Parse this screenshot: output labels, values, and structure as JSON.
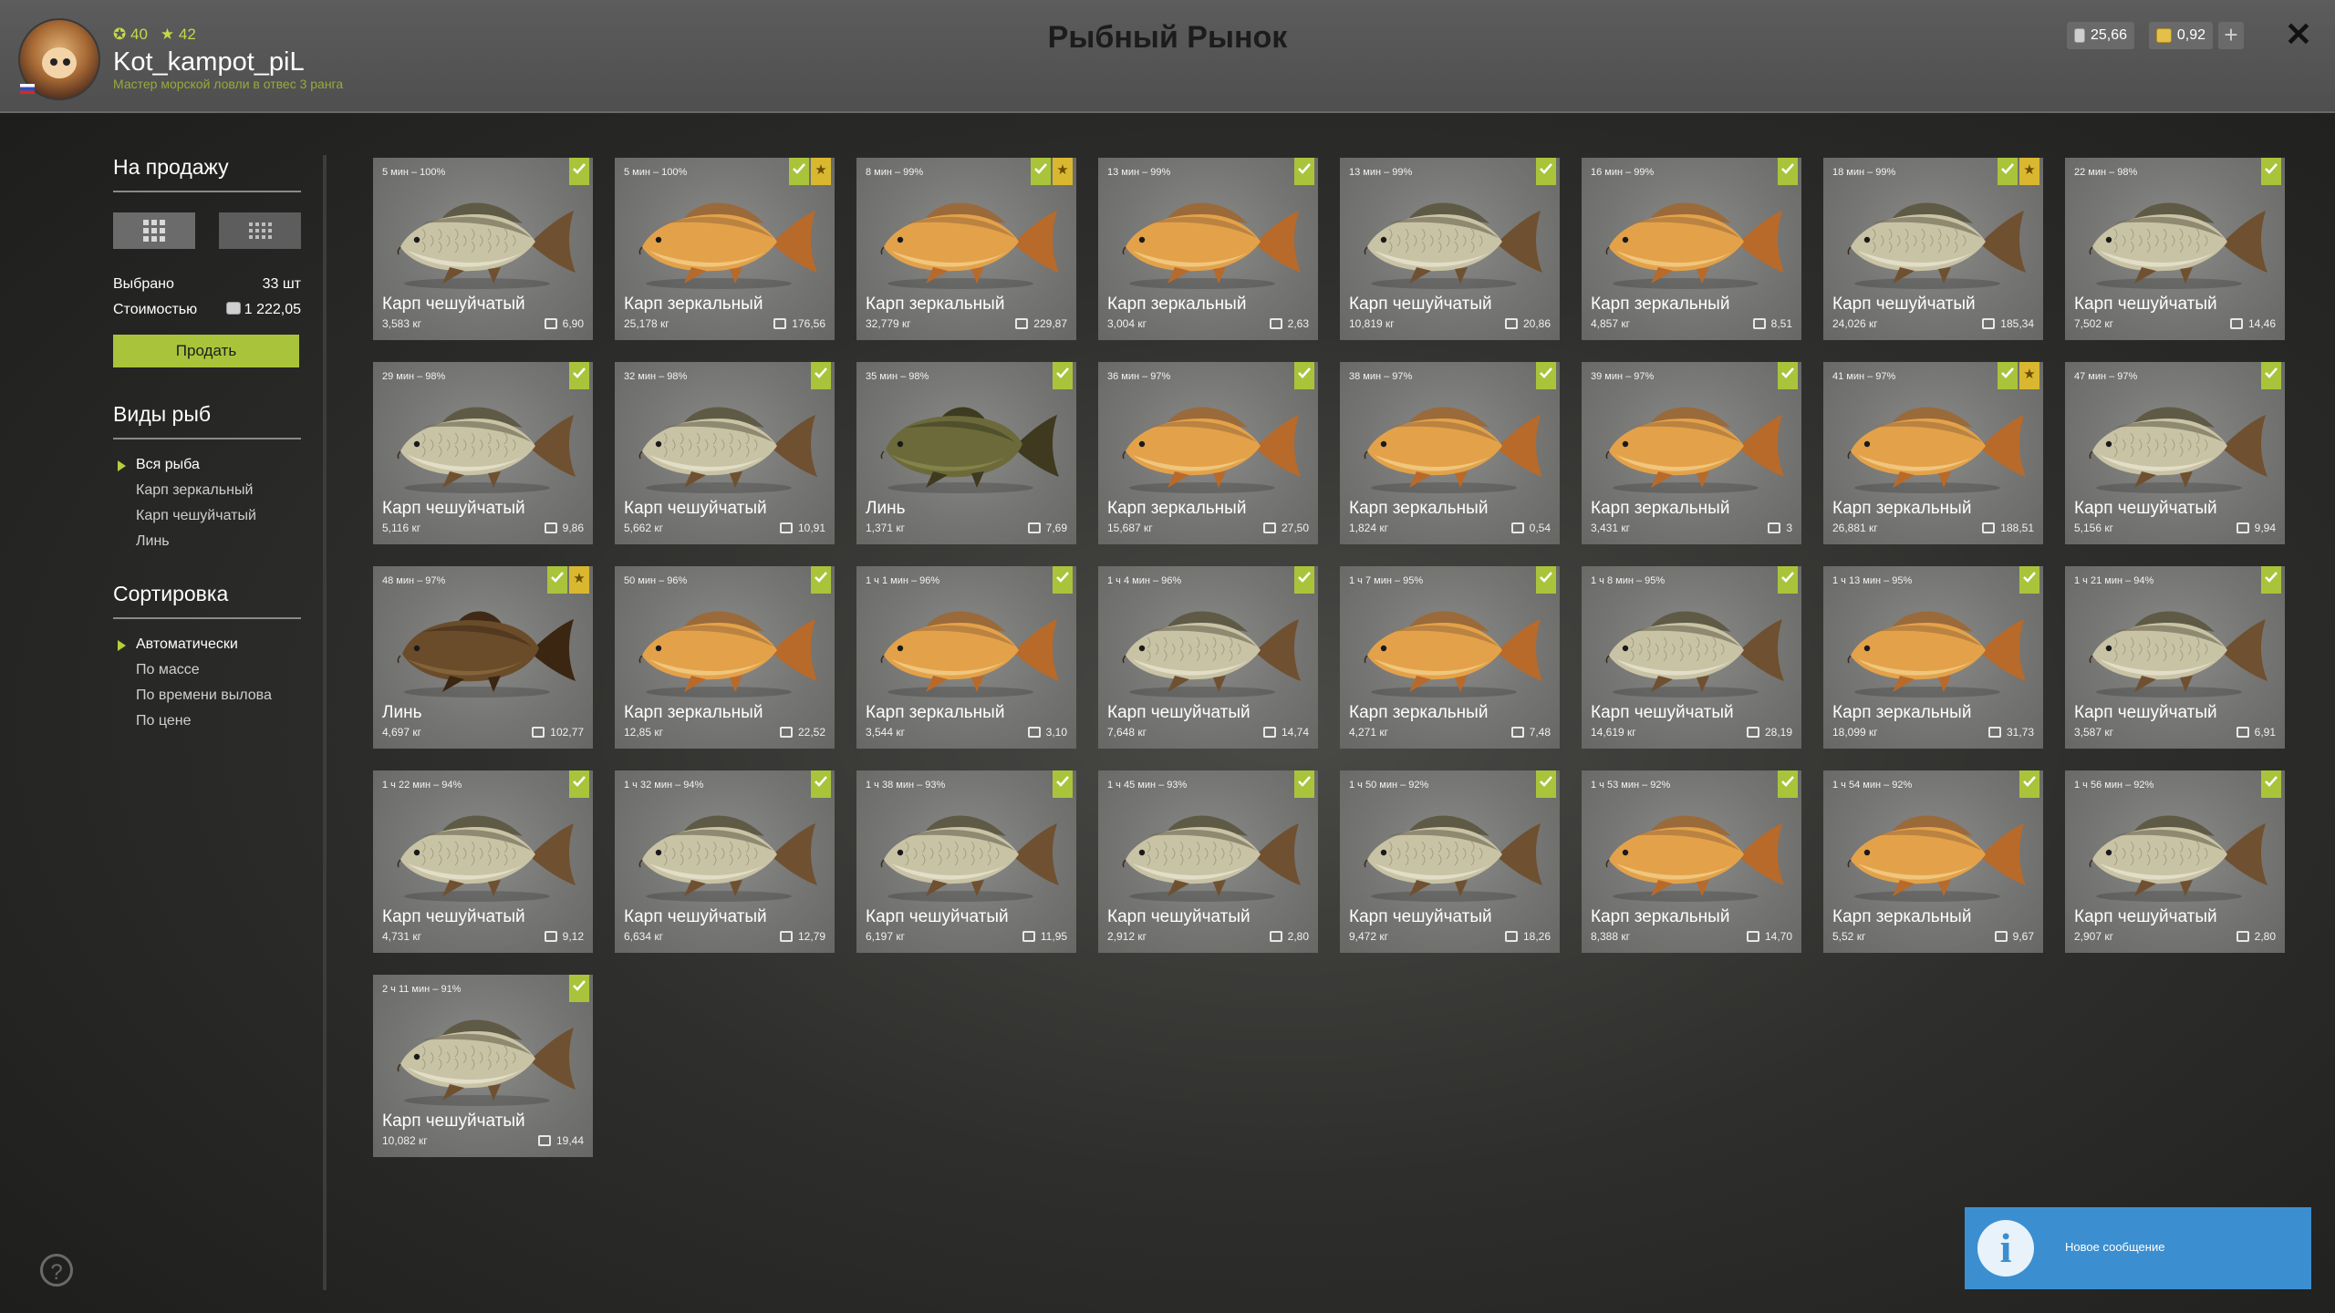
{
  "header": {
    "title": "Рыбный Рынок",
    "player": {
      "level_points": "40",
      "stars": "42",
      "username": "Kot_kampot_piL",
      "rank": "Мастер морской ловли в отвес 3 ранга"
    },
    "silver": "25,66",
    "gold": "0,92",
    "plus_label": "+",
    "close_label": "✕"
  },
  "sidebar": {
    "for_sale_title": "На продажу",
    "selected_label": "Выбрано",
    "selected_value": "33 шт",
    "cost_label": "Стоимостью",
    "cost_value": "1 222,05",
    "sell_label": "Продать",
    "fish_types_title": "Виды рыб",
    "fish_types": [
      "Вся рыба",
      "Карп зеркальный",
      "Карп чешуйчатый",
      "Линь"
    ],
    "sort_title": "Сортировка",
    "sort_options": [
      "Автоматически",
      "По массе",
      "По времени вылова",
      "По цене"
    ]
  },
  "toast": {
    "icon": "i",
    "message": "Новое сообщение"
  },
  "help_icon": "?",
  "colors": {
    "accent": "#a9c43a",
    "star": "#d9b830",
    "toast": "#3b8fd0"
  },
  "fish": [
    {
      "time": "5 мин – 100%",
      "name": "Карп чешуйчатый",
      "weight": "3,583 кг",
      "price": "6,90",
      "kind": "common",
      "star": false
    },
    {
      "time": "5 мин – 100%",
      "name": "Карп зеркальный",
      "weight": "25,178 кг",
      "price": "176,56",
      "kind": "mirror",
      "star": true
    },
    {
      "time": "8 мин – 99%",
      "name": "Карп зеркальный",
      "weight": "32,779 кг",
      "price": "229,87",
      "kind": "mirror",
      "star": true
    },
    {
      "time": "13 мин – 99%",
      "name": "Карп зеркальный",
      "weight": "3,004 кг",
      "price": "2,63",
      "kind": "mirror",
      "star": false
    },
    {
      "time": "13 мин – 99%",
      "name": "Карп чешуйчатый",
      "weight": "10,819 кг",
      "price": "20,86",
      "kind": "common",
      "star": false
    },
    {
      "time": "16 мин – 99%",
      "name": "Карп зеркальный",
      "weight": "4,857 кг",
      "price": "8,51",
      "kind": "mirror",
      "star": false
    },
    {
      "time": "18 мин – 99%",
      "name": "Карп чешуйчатый",
      "weight": "24,026 кг",
      "price": "185,34",
      "kind": "common",
      "star": true
    },
    {
      "time": "22 мин – 98%",
      "name": "Карп чешуйчатый",
      "weight": "7,502 кг",
      "price": "14,46",
      "kind": "common",
      "star": false
    },
    {
      "time": "29 мин – 98%",
      "name": "Карп чешуйчатый",
      "weight": "5,116 кг",
      "price": "9,86",
      "kind": "common",
      "star": false
    },
    {
      "time": "32 мин – 98%",
      "name": "Карп чешуйчатый",
      "weight": "5,662 кг",
      "price": "10,91",
      "kind": "common",
      "star": false
    },
    {
      "time": "35 мин – 98%",
      "name": "Линь",
      "weight": "1,371 кг",
      "price": "7,69",
      "kind": "tench",
      "star": false
    },
    {
      "time": "36 мин – 97%",
      "name": "Карп зеркальный",
      "weight": "15,687 кг",
      "price": "27,50",
      "kind": "mirror",
      "star": false
    },
    {
      "time": "38 мин – 97%",
      "name": "Карп зеркальный",
      "weight": "1,824 кг",
      "price": "0,54",
      "kind": "mirror",
      "star": false
    },
    {
      "time": "39 мин – 97%",
      "name": "Карп зеркальный",
      "weight": "3,431 кг",
      "price": "3",
      "kind": "mirror",
      "star": false
    },
    {
      "time": "41 мин – 97%",
      "name": "Карп зеркальный",
      "weight": "26,881 кг",
      "price": "188,51",
      "kind": "mirror",
      "star": true
    },
    {
      "time": "47 мин – 97%",
      "name": "Карп чешуйчатый",
      "weight": "5,156 кг",
      "price": "9,94",
      "kind": "common",
      "star": false
    },
    {
      "time": "48 мин – 97%",
      "name": "Линь",
      "weight": "4,697 кг",
      "price": "102,77",
      "kind": "tench2",
      "star": true
    },
    {
      "time": "50 мин – 96%",
      "name": "Карп зеркальный",
      "weight": "12,85 кг",
      "price": "22,52",
      "kind": "mirror",
      "star": false
    },
    {
      "time": "1 ч 1 мин – 96%",
      "name": "Карп зеркальный",
      "weight": "3,544 кг",
      "price": "3,10",
      "kind": "mirror",
      "star": false
    },
    {
      "time": "1 ч 4 мин – 96%",
      "name": "Карп чешуйчатый",
      "weight": "7,648 кг",
      "price": "14,74",
      "kind": "common",
      "star": false
    },
    {
      "time": "1 ч 7 мин – 95%",
      "name": "Карп зеркальный",
      "weight": "4,271 кг",
      "price": "7,48",
      "kind": "mirror",
      "star": false
    },
    {
      "time": "1 ч 8 мин – 95%",
      "name": "Карп чешуйчатый",
      "weight": "14,619 кг",
      "price": "28,19",
      "kind": "common",
      "star": false
    },
    {
      "time": "1 ч 13 мин – 95%",
      "name": "Карп зеркальный",
      "weight": "18,099 кг",
      "price": "31,73",
      "kind": "mirror",
      "star": false
    },
    {
      "time": "1 ч 21 мин – 94%",
      "name": "Карп чешуйчатый",
      "weight": "3,587 кг",
      "price": "6,91",
      "kind": "common",
      "star": false
    },
    {
      "time": "1 ч 22 мин – 94%",
      "name": "Карп чешуйчатый",
      "weight": "4,731 кг",
      "price": "9,12",
      "kind": "common",
      "star": false
    },
    {
      "time": "1 ч 32 мин – 94%",
      "name": "Карп чешуйчатый",
      "weight": "6,634 кг",
      "price": "12,79",
      "kind": "common",
      "star": false
    },
    {
      "time": "1 ч 38 мин – 93%",
      "name": "Карп чешуйчатый",
      "weight": "6,197 кг",
      "price": "11,95",
      "kind": "common",
      "star": false
    },
    {
      "time": "1 ч 45 мин – 93%",
      "name": "Карп чешуйчатый",
      "weight": "2,912 кг",
      "price": "2,80",
      "kind": "common",
      "star": false
    },
    {
      "time": "1 ч 50 мин – 92%",
      "name": "Карп чешуйчатый",
      "weight": "9,472 кг",
      "price": "18,26",
      "kind": "common",
      "star": false
    },
    {
      "time": "1 ч 53 мин – 92%",
      "name": "Карп зеркальный",
      "weight": "8,388 кг",
      "price": "14,70",
      "kind": "mirror",
      "star": false
    },
    {
      "time": "1 ч 54 мин – 92%",
      "name": "Карп зеркальный",
      "weight": "5,52 кг",
      "price": "9,67",
      "kind": "mirror",
      "star": false
    },
    {
      "time": "1 ч 56 мин – 92%",
      "name": "Карп чешуйчатый",
      "weight": "2,907 кг",
      "price": "2,80",
      "kind": "common",
      "star": false
    },
    {
      "time": "2 ч 11 мин – 91%",
      "name": "Карп чешуйчатый",
      "weight": "10,082 кг",
      "price": "19,44",
      "kind": "common",
      "star": false
    }
  ]
}
